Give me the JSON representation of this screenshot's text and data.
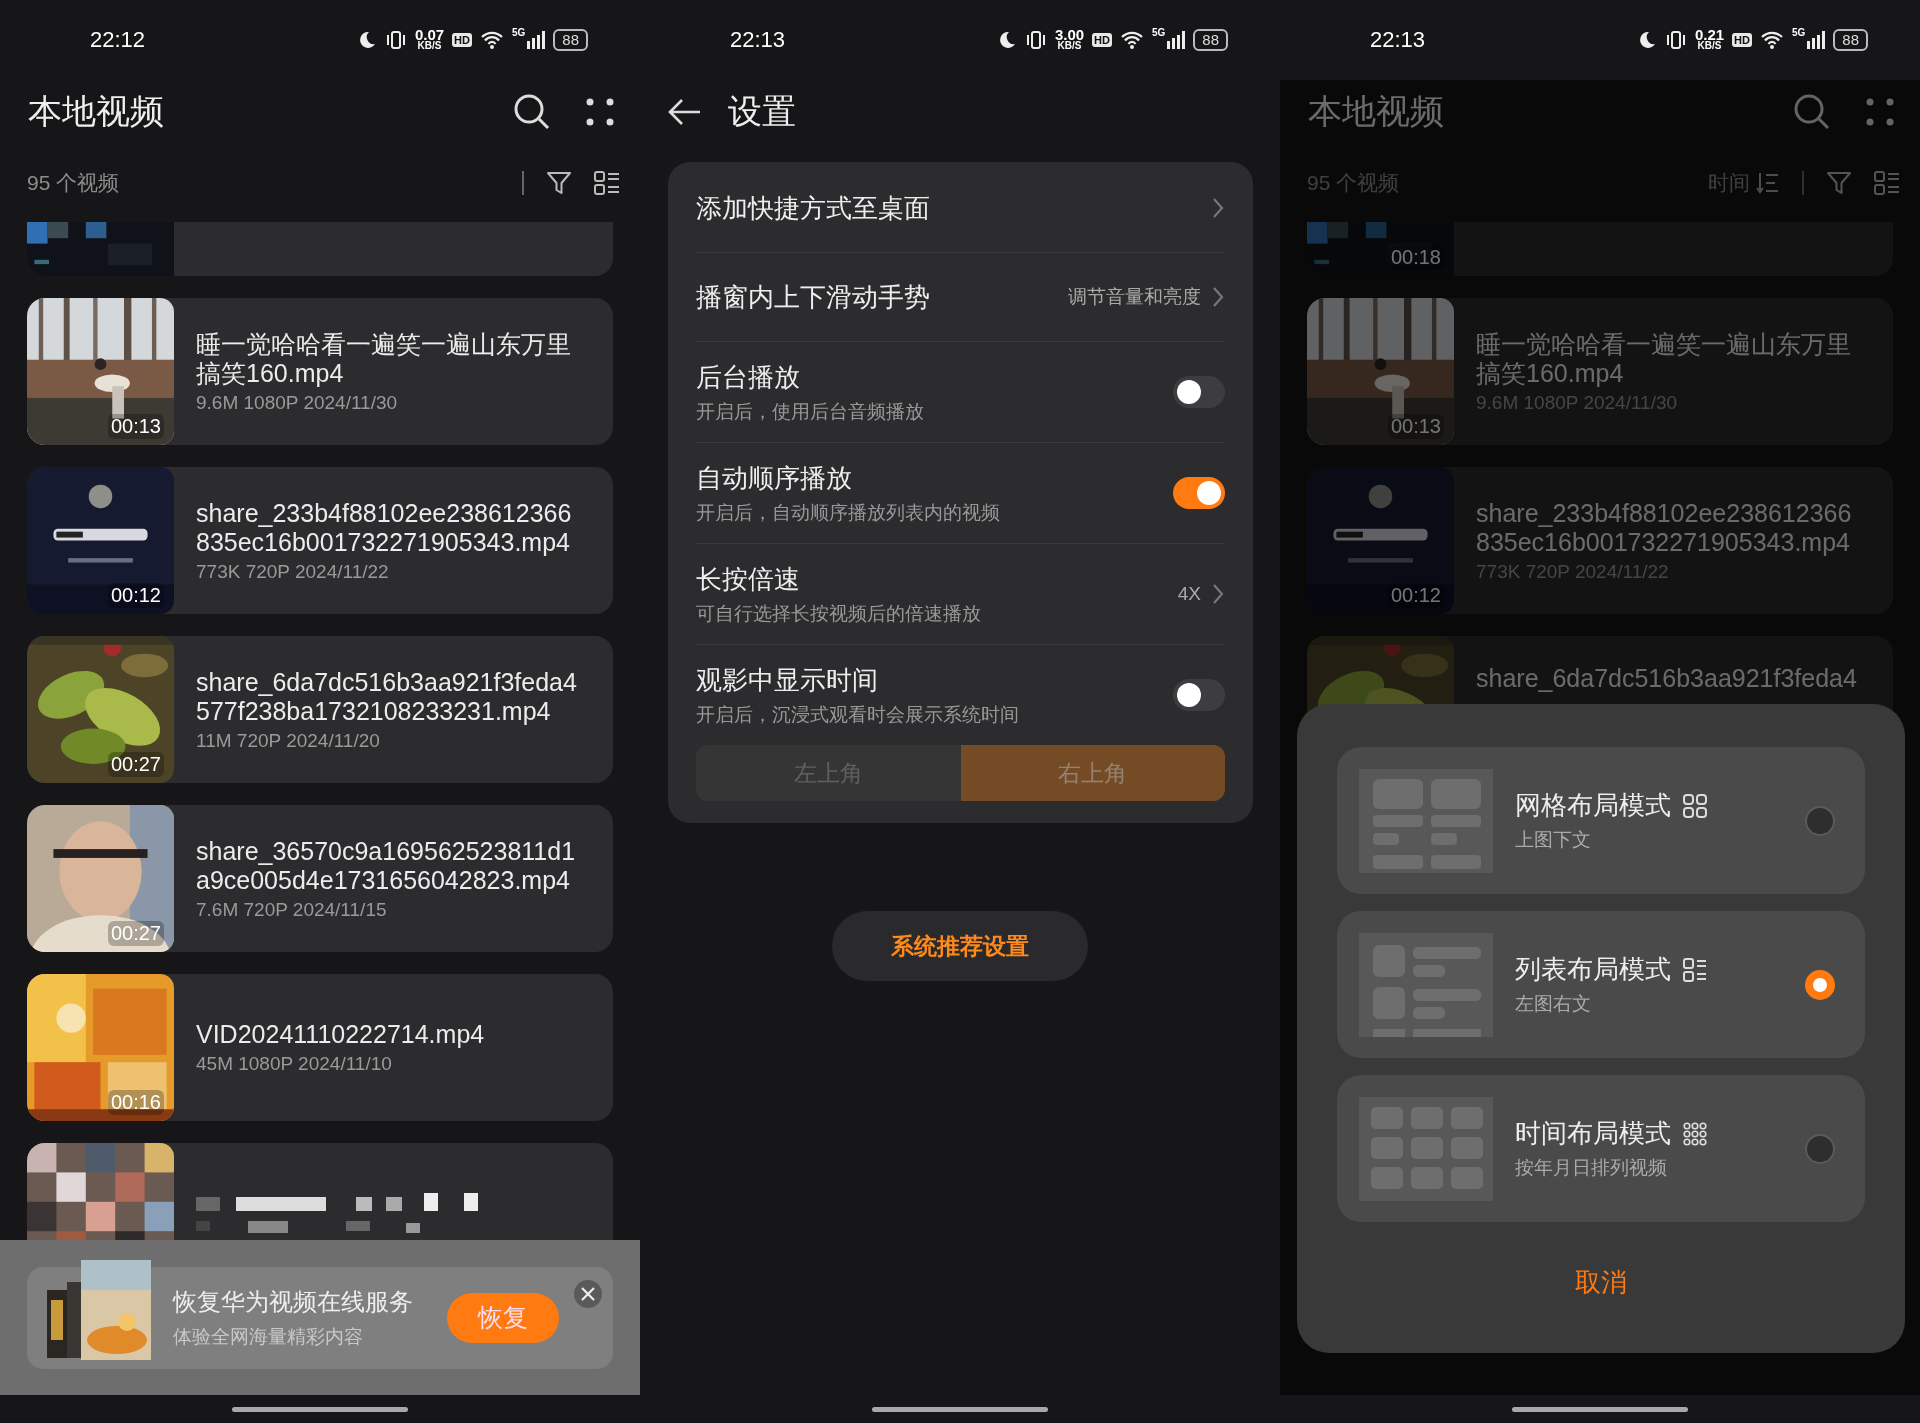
{
  "screens": [
    {
      "kind": "video_list",
      "status_bar": {
        "time": "22:12",
        "speed": "0.07",
        "speed_unit": "KB/S",
        "hd": "HD",
        "network": "5G",
        "battery": "88"
      },
      "title": "本地视频",
      "count": "95 个视频",
      "dimmed": false,
      "videos": [
        {
          "partial": true
        },
        {
          "title": "睡一觉哈哈看一遍笑一遍山东万里搞笑160.mp4",
          "meta": "9.6M 1080P 2024/11/30",
          "duration": "00:13"
        },
        {
          "title": "share_233b4f88102ee238612366835ec16b001732271905343.mp4",
          "meta": "773K 720P 2024/11/22",
          "duration": "00:12"
        },
        {
          "title": "share_6da7dc516b3aa921f3feda4577f238ba1732108233231.mp4",
          "meta": "11M 720P 2024/11/20",
          "duration": "00:27"
        },
        {
          "title": "share_36570c9a169562523811d1a9ce005d4e1731656042823.mp4",
          "meta": "7.6M 720P 2024/11/15",
          "duration": "00:27"
        },
        {
          "title": "VID20241110222714.mp4",
          "meta": "45M 1080P 2024/11/10",
          "duration": "00:16"
        },
        {
          "obscured": true
        }
      ],
      "banner": {
        "title": "恢复华为视频在线服务",
        "subtitle": "体验全网海量精彩内容",
        "button": "恢复"
      }
    },
    {
      "kind": "settings",
      "status_bar": {
        "time": "22:13",
        "speed": "3.00",
        "speed_unit": "KB/S",
        "hd": "HD",
        "network": "5G",
        "battery": "88"
      },
      "title": "设置",
      "rows": [
        {
          "kind": "link",
          "title": "添加快捷方式至桌面"
        },
        {
          "kind": "link",
          "title": "播窗内上下滑动手势",
          "value": "调节音量和亮度"
        },
        {
          "kind": "switch",
          "title": "后台播放",
          "subtitle": "开启后，使用后台音频播放",
          "on": false
        },
        {
          "kind": "switch",
          "title": "自动顺序播放",
          "subtitle": "开启后，自动顺序播放列表内的视频",
          "on": true
        },
        {
          "kind": "link",
          "title": "长按倍速",
          "subtitle": "可自行选择长按视频后的倍速播放",
          "value": "4X"
        },
        {
          "kind": "switch",
          "title": "观影中显示时间",
          "subtitle": "开启后，沉浸式观看时会展示系统时间",
          "on": false,
          "segments": [
            {
              "label": "左上角",
              "selected": false
            },
            {
              "label": "右上角",
              "selected": true
            }
          ]
        }
      ],
      "button": "系统推荐设置"
    },
    {
      "kind": "video_list",
      "status_bar": {
        "time": "22:13",
        "speed": "0.21",
        "speed_unit": "KB/S",
        "hd": "HD",
        "network": "5G",
        "battery": "88"
      },
      "title": "本地视频",
      "count": "95 个视频",
      "sort_label": "时间",
      "dimmed": true,
      "videos": [
        {
          "partial": true,
          "duration": "00:18"
        },
        {
          "title": "睡一觉哈哈看一遍笑一遍山东万里搞笑160.mp4",
          "meta": "9.6M 1080P 2024/11/30",
          "duration": "00:13"
        },
        {
          "title": "share_233b4f88102ee238612366835ec16b001732271905343.mp4",
          "meta": "773K 720P 2024/11/22",
          "duration": "00:12"
        },
        {
          "title": "share_6da7dc516b3aa921f3feda4"
        }
      ],
      "layout_sheet": {
        "options": [
          {
            "kind": "grid",
            "title": "网格布局模式",
            "subtitle": "上图下文",
            "selected": false
          },
          {
            "kind": "list",
            "title": "列表布局模式",
            "subtitle": "左图右文",
            "selected": true
          },
          {
            "kind": "timeline",
            "title": "时间布局模式",
            "subtitle": "按年月日排列视频",
            "selected": false
          }
        ],
        "cancel": "取消"
      }
    }
  ]
}
